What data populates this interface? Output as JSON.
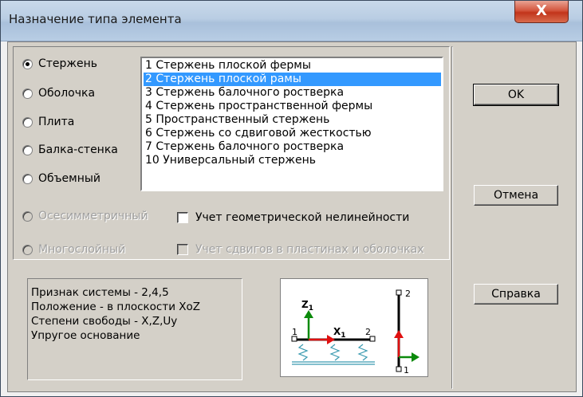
{
  "window": {
    "title": "Назначение типа элемента",
    "close_glyph": "X"
  },
  "element_types": [
    {
      "label": "Стержень",
      "selected": true,
      "enabled": true
    },
    {
      "label": "Оболочка",
      "selected": false,
      "enabled": true
    },
    {
      "label": "Плита",
      "selected": false,
      "enabled": true
    },
    {
      "label": "Балка-стенка",
      "selected": false,
      "enabled": true
    },
    {
      "label": "Объемный",
      "selected": false,
      "enabled": true
    },
    {
      "label": "Осесимметричный",
      "selected": false,
      "enabled": false
    },
    {
      "label": "Многослойный",
      "selected": false,
      "enabled": false
    }
  ],
  "list": {
    "items": [
      "1 Стержень плоской фермы",
      "2 Стержень плоской рамы",
      "3 Стержень балочного ростверка",
      "4 Стержень пространственной фермы",
      "5 Пространственный стержень",
      "6 Стержень со сдвиговой жесткостью",
      "7 Стержень балочного ростверка",
      "10 Универсальный стержень"
    ],
    "selected_index": 1
  },
  "options": {
    "geometric_nonlinearity": {
      "label": "Учет геометрической нелинейности",
      "checked": false,
      "enabled": true
    },
    "shear_in_plates": {
      "label": "Учет сдвигов в пластинах и оболочках",
      "checked": false,
      "enabled": false
    }
  },
  "buttons": {
    "ok": "OK",
    "cancel": "Отмена",
    "help": "Справка"
  },
  "info": [
    "Признак системы - 2,4,5",
    "Положение - в плоскости XoZ",
    "Степени свободы - X,Z,Uy",
    "Упругое основание"
  ],
  "diagram": {
    "z_axis": "Z",
    "x_axis": "X",
    "axis_subscript": "1",
    "node_start": "1",
    "node_end": "2",
    "vertical_top": "2",
    "vertical_bottom": "1",
    "colors": {
      "z": "#0b8a0b",
      "x": "#e01010",
      "spring": "#3a9ab0",
      "bar": "#000000"
    }
  }
}
